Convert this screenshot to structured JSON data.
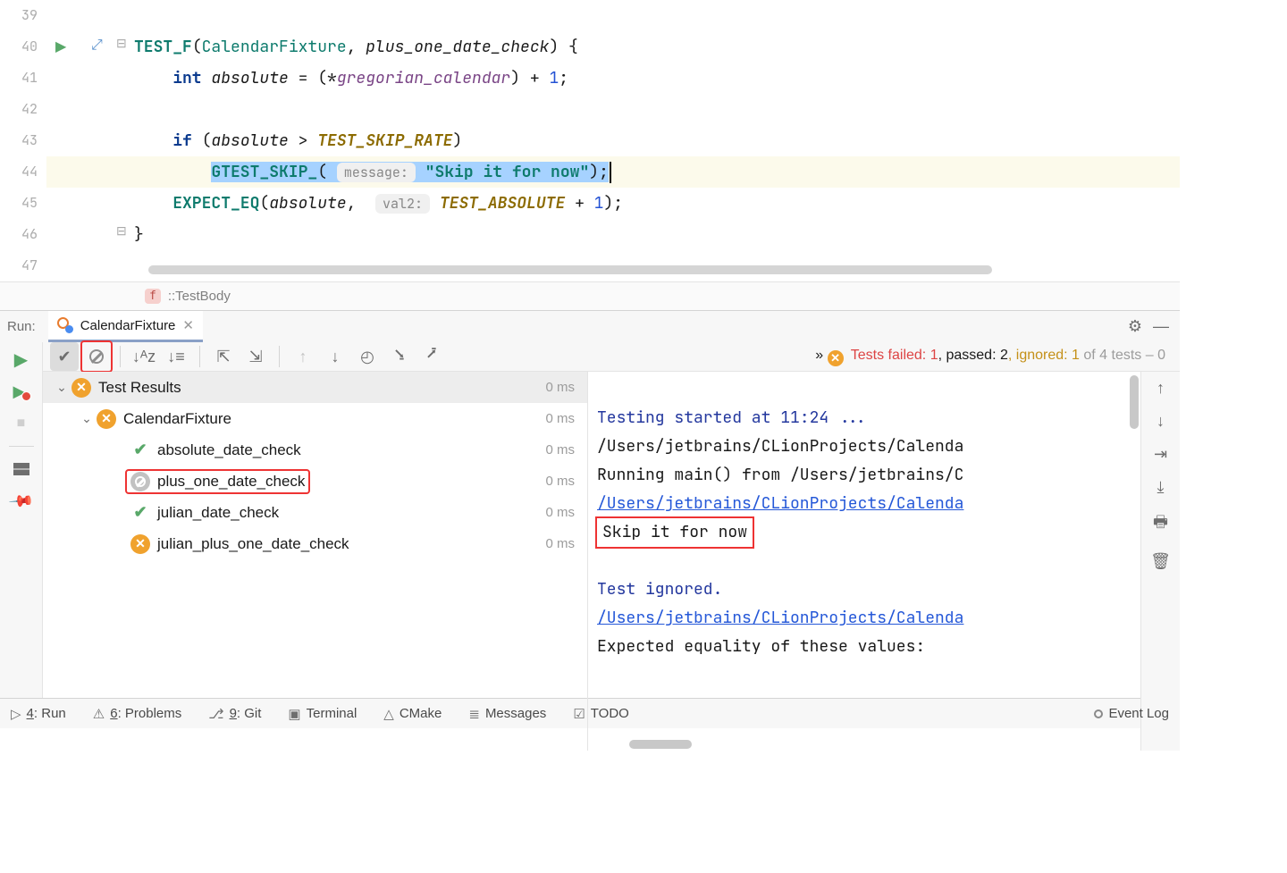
{
  "editor": {
    "lines": [
      "39",
      "40",
      "41",
      "42",
      "43",
      "44",
      "45",
      "46",
      "47"
    ],
    "code": {
      "test_f": "TEST_F",
      "fixture": "CalendarFixture",
      "testname": "plus_one_date_check",
      "int_kw": "int",
      "absolute": "absolute",
      "gregorian": "gregorian_calendar",
      "one": "1",
      "if_kw": "if",
      "skip_rate": "TEST_SKIP_RATE",
      "gtest_skip": "GTEST_SKIP_",
      "msg_hint": "message:",
      "skip_str": "\"Skip it for now\"",
      "expect_eq": "EXPECT_EQ",
      "val2_hint": "val2:",
      "test_abs": "TEST_ABSOLUTE"
    }
  },
  "breadcrumb": {
    "badge": "f",
    "text": "::TestBody"
  },
  "run": {
    "label": "Run:",
    "tab": "CalendarFixture",
    "summary": {
      "chev": "»",
      "failed_label": "Tests failed: ",
      "failed_n": "1",
      "passed_label": ", passed: ",
      "passed_n": "2",
      "ignored_label": ", ignored: ",
      "ignored_n": "1",
      "tail": " of 4 tests – 0"
    },
    "tree": {
      "root": {
        "name": "Test Results",
        "time": "0 ms"
      },
      "suite": {
        "name": "CalendarFixture",
        "time": "0 ms"
      },
      "tests": [
        {
          "name": "absolute_date_check",
          "time": "0 ms",
          "status": "pass"
        },
        {
          "name": "plus_one_date_check",
          "time": "0 ms",
          "status": "skip",
          "highlight": true
        },
        {
          "name": "julian_date_check",
          "time": "0 ms",
          "status": "pass"
        },
        {
          "name": "julian_plus_one_date_check",
          "time": "0 ms",
          "status": "warn"
        }
      ]
    },
    "console": {
      "l1": "Testing started at 11:24 ...",
      "l2": "/Users/jetbrains/CLionProjects/Calenda",
      "l3": "Running main() from /Users/jetbrains/C",
      "l4": "/Users/jetbrains/CLionProjects/Calenda",
      "l5": "Skip it for now",
      "l6": "Test ignored.",
      "l7": "/Users/jetbrains/CLionProjects/Calenda",
      "l8": "Expected equality of these values:"
    }
  },
  "status": {
    "run": "Run",
    "run_n": "4",
    "problems": "Problems",
    "problems_n": "6",
    "git": "Git",
    "git_n": "9",
    "terminal": "Terminal",
    "cmake": "CMake",
    "messages": "Messages",
    "todo": "TODO",
    "event_log": "Event Log"
  }
}
